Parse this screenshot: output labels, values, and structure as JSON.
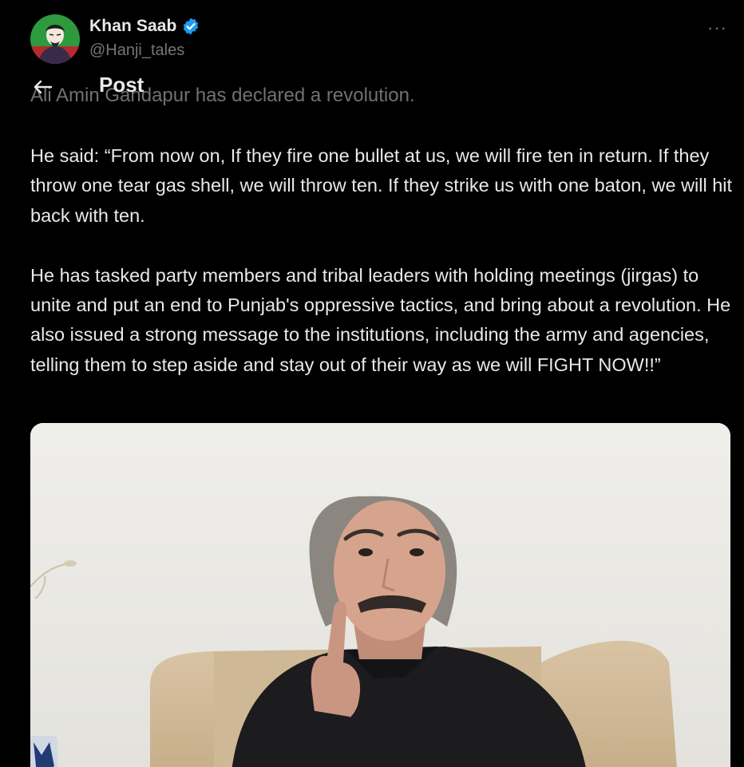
{
  "header": {
    "back_icon": "arrow-left-icon",
    "title": "Post"
  },
  "author": {
    "display_name": "Khan Saab",
    "verified": true,
    "verified_color": "#1d9bf0",
    "handle": "@Hanji_tales"
  },
  "more_label": "···",
  "post": {
    "faded_line": "Ali Amin Gandapur has declared a revolution.",
    "paragraphs": [
      "He said: “From now on, If they fire one bullet at us, we will fire ten in return. If they throw one tear gas shell, we will throw ten. If they strike us with one baton, we will hit back with ten.",
      "He has tasked party members and tribal leaders with holding meetings (jirgas) to unite and put an end to Punjab's oppressive tactics, and bring about a revolution. He also issued a strong message to the institutions, including the army and agencies, telling them to step aside and stay out of their way as we will FIGHT NOW!!”"
    ]
  },
  "colors": {
    "background": "#000000",
    "text_primary": "#e7e9ea",
    "text_secondary": "#71767b",
    "accent": "#1d9bf0"
  }
}
